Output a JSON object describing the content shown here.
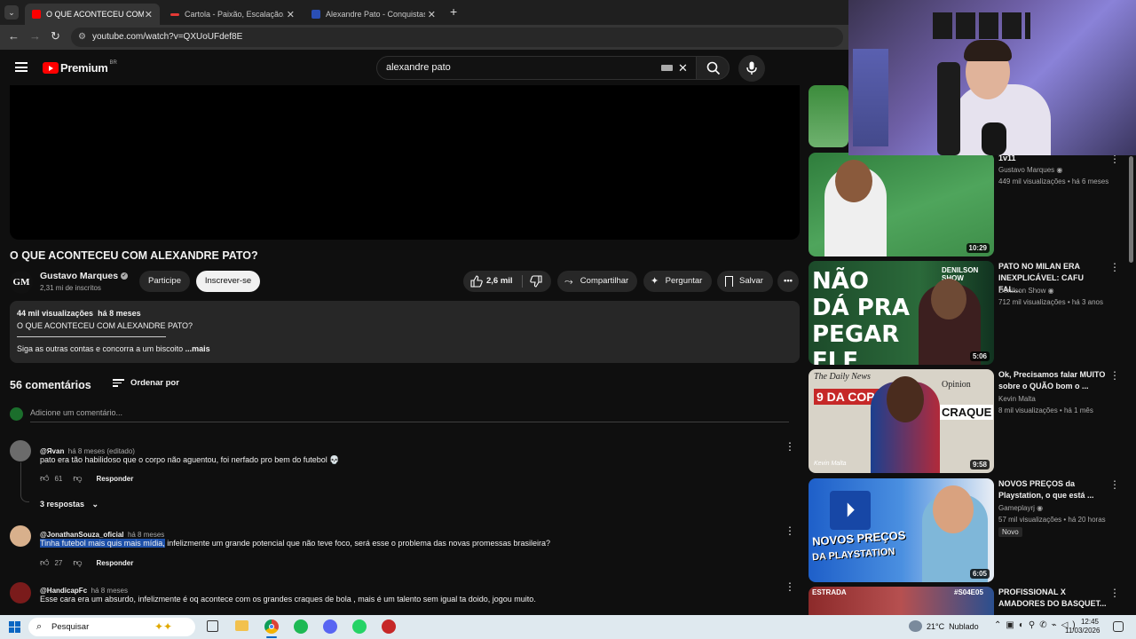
{
  "browser": {
    "tabs": [
      {
        "label": "O QUE ACONTECEU COM ALEX",
        "favicon_color": "#ff0000"
      },
      {
        "label": "Cartola - Paixão, Escalação, Zo",
        "favicon_color": "#e53935"
      },
      {
        "label": "Alexandre Pato - Conquistas | T",
        "favicon_color": "#2a4fb5"
      }
    ],
    "url": "youtube.com/watch?v=QXUoUFdef8E"
  },
  "yt": {
    "logo": "Premium",
    "logo_region": "BR",
    "search_value": "alexandre pato"
  },
  "video": {
    "title": "O QUE ACONTECEU COM ALEXANDRE PATO?",
    "channel": "Gustavo Marques",
    "channel_initials": "GM",
    "subscribers": "2,31 mi de inscritos",
    "join_label": "Participe",
    "subscribe_label": "Inscrever-se",
    "likes": "2,6 mil",
    "share_label": "Compartilhar",
    "ask_label": "Perguntar",
    "save_label": "Salvar"
  },
  "description": {
    "views": "44 mil visualizações",
    "age": "há 8 meses",
    "line1": "O QUE ACONTECEU COM ALEXANDRE PATO?",
    "line2": "Siga as outras contas e concorra a um biscoito",
    "more": "...mais"
  },
  "comments": {
    "count_label": "56 comentários",
    "sort_label": "Ordenar por",
    "add_placeholder": "Adicione um comentário...",
    "reply_label": "Responder",
    "items": [
      {
        "author": "@Яvan",
        "time": "há 8 meses (editado)",
        "text": "pato era tão habilidoso que o corpo não aguentou, foi nerfado pro bem do futebol 💀",
        "likes": "61",
        "replies": "3 respostas"
      },
      {
        "author": "@JonathanSouza_oficial",
        "time": "há 8 meses",
        "text_highlight": "Tinha futebol mais quis mais mídia,",
        "text": " infelizmente um grande potencial que não teve foco, será esse o problema das novas promessas brasileira?",
        "likes": "27"
      },
      {
        "author": "@HandicapFc",
        "time": "há 8 meses",
        "text": "Esse cara era um absurdo, infelizmente é oq acontece com os grandes craques de bola , mais é um talento sem igual ta doido, jogou muito."
      }
    ]
  },
  "sidebar": [
    {
      "title": "1v11",
      "channel": "Gustavo Marques",
      "meta": "449 mil visualizações • há 6 meses",
      "duration": "10:29"
    },
    {
      "title": "PATO NO MILAN ERA INEXPLICÁVEL: CAFU FAL...",
      "channel": "Denilson Show",
      "meta": "712 mil visualizações • há 3 anos",
      "duration": "5:06",
      "thumb_text": "NÃO DÁ PRA PEGAR ELE",
      "thumb_badge": "DENILSON SHOW"
    },
    {
      "title": "Ok, Precisamos falar MUITO sobre o QUÃO bom o ...",
      "channel": "Kevin Malta",
      "meta": "8 mil visualizações • há 1 mês",
      "duration": "9:58",
      "thumb_text_a": "9 DA COPA",
      "thumb_text_b": "CRAQUE",
      "thumb_paper": "The Daily News",
      "thumb_opinion": "Opinion",
      "thumb_sign": "Kevin Malta"
    },
    {
      "title": "NOVOS PREÇOS da Playstation, o que está ...",
      "channel": "Gameplayrj",
      "meta": "57 mil visualizações • há 20 horas",
      "badge": "Novo",
      "duration": "6:05",
      "thumb_text": "NOVOS PREÇOS",
      "thumb_text_b": "DA PLAYSTATION"
    },
    {
      "title": "PROFISSIONAL X AMADORES DO BASQUET...",
      "thumb_text": "#S04E05",
      "thumb_text_b": "ESTRADA"
    }
  ],
  "taskbar": {
    "search_label": "Pesquisar",
    "weather": "21°C  Nublado",
    "time": "12:45",
    "date": "11/03/2026"
  }
}
